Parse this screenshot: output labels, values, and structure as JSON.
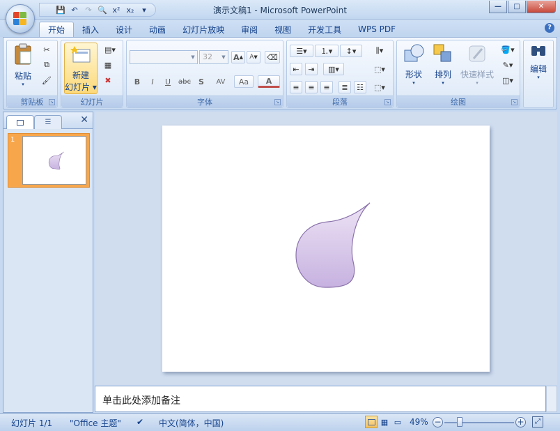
{
  "window": {
    "title": "演示文稿1 - Microsoft PowerPoint",
    "min": "—",
    "max": "□",
    "close": "✕"
  },
  "qat": {
    "save": "💾",
    "undo": "↶",
    "redo": "↷",
    "preview": "🔍",
    "superscript": "x²",
    "subscript": "x₂",
    "more": "▾"
  },
  "tabs": [
    "开始",
    "插入",
    "设计",
    "动画",
    "幻灯片放映",
    "审阅",
    "视图",
    "开发工具",
    "WPS PDF"
  ],
  "ribbon": {
    "clipboard": {
      "label": "剪贴板",
      "paste": "粘贴"
    },
    "slides": {
      "label": "幻灯片",
      "new_slide_line1": "新建",
      "new_slide_line2": "幻灯片"
    },
    "font": {
      "label": "字体",
      "font_name": "",
      "font_size": "32",
      "bold": "B",
      "italic": "I",
      "underline": "U",
      "strike": "abc",
      "shadow": "S",
      "spacing": "AV",
      "case": "Aa",
      "color": "A",
      "grow": "A",
      "shrink": "A"
    },
    "paragraph": {
      "label": "段落"
    },
    "drawing": {
      "label": "绘图",
      "shapes": "形状",
      "arrange": "排列",
      "quick_styles": "快速样式"
    },
    "editing": {
      "label": "编辑"
    }
  },
  "slides_pane": {
    "slide_number": "1",
    "close": "✕"
  },
  "notes": {
    "placeholder": "单击此处添加备注"
  },
  "status": {
    "slide_info": "幻灯片 1/1",
    "theme": "\"Office 主题\"",
    "language": "中文(简体，中国)",
    "zoom": "49%",
    "zoom_out": "−",
    "zoom_in": "+"
  },
  "colors": {
    "shape_fill_top": "#ede3f5",
    "shape_fill_bottom": "#c7b2e0",
    "shape_stroke": "#8a72ab",
    "thumb_selected": "#f7a64b"
  }
}
